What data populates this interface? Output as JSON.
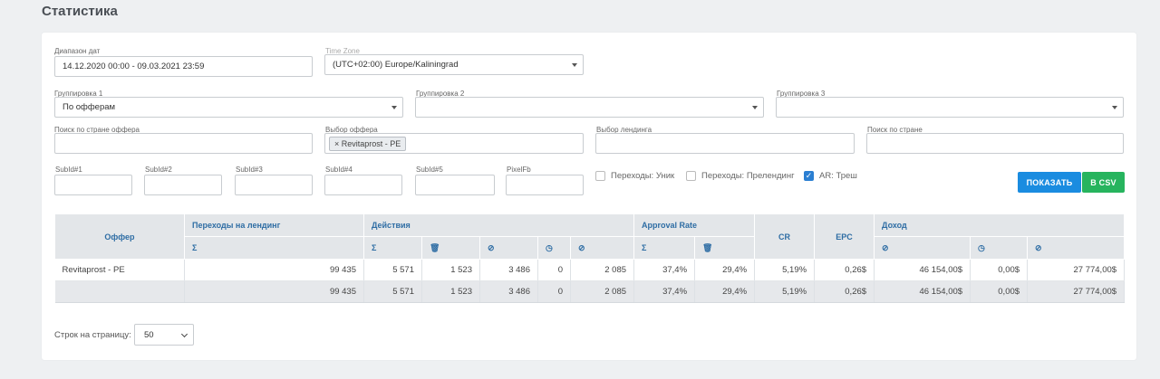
{
  "page_title": "Статистика",
  "filters": {
    "date_range": {
      "label": "Диапазон дат",
      "value": "14.12.2020 00:00 - 09.03.2021 23:59"
    },
    "time_zone": {
      "label": "Time Zone",
      "value": "(UTC+02:00) Europe/Kaliningrad"
    },
    "group1": {
      "label": "Группировка 1",
      "value": "По офферам"
    },
    "group2": {
      "label": "Группировка 2",
      "value": ""
    },
    "group3": {
      "label": "Группировка 3",
      "value": ""
    },
    "offer_country": {
      "label": "Поиск по стране оффера",
      "value": ""
    },
    "offer_select": {
      "label": "Выбор оффера",
      "tag": "× Revitaprost - PE"
    },
    "landing_select": {
      "label": "Выбор лендинга",
      "value": ""
    },
    "country_search": {
      "label": "Поиск по стране",
      "value": ""
    },
    "subids": [
      "SubId#1",
      "SubId#2",
      "SubId#3",
      "SubId#4",
      "SubId#5",
      "PixelFb"
    ],
    "checkboxes": [
      {
        "label": "Переходы: Уник",
        "checked": false
      },
      {
        "label": "Переходы: Прелендинг",
        "checked": false
      },
      {
        "label": "AR: Треш",
        "checked": true
      }
    ],
    "show_button": "ПОКАЗАТЬ",
    "csv_button": "В CSV"
  },
  "table": {
    "groups": {
      "offer": "Оффер",
      "landing_clicks": "Переходы на лендинг",
      "actions": "Действия",
      "approval_rate": "Approval Rate",
      "cr": "CR",
      "epc": "EPC",
      "income": "Доход"
    },
    "sub_icons": {
      "sum": "Σ",
      "trash": "🗑",
      "blocked": "⊘",
      "clock": "◷",
      "check": "⊘"
    },
    "rows": [
      {
        "name": "Revitaprost - PE",
        "cells": [
          "99 435",
          "5 571",
          "1 523",
          "3 486",
          "0",
          "2 085",
          "37,4%",
          "29,4%",
          "5,19%",
          "0,26$",
          "46 154,00$",
          "0,00$",
          "27 774,00$"
        ]
      },
      {
        "name": "",
        "cells": [
          "99 435",
          "5 571",
          "1 523",
          "3 486",
          "0",
          "2 085",
          "37,4%",
          "29,4%",
          "5,19%",
          "0,26$",
          "46 154,00$",
          "0,00$",
          "27 774,00$"
        ]
      }
    ]
  },
  "pager": {
    "label": "Строк на страницу:",
    "value": "50"
  }
}
